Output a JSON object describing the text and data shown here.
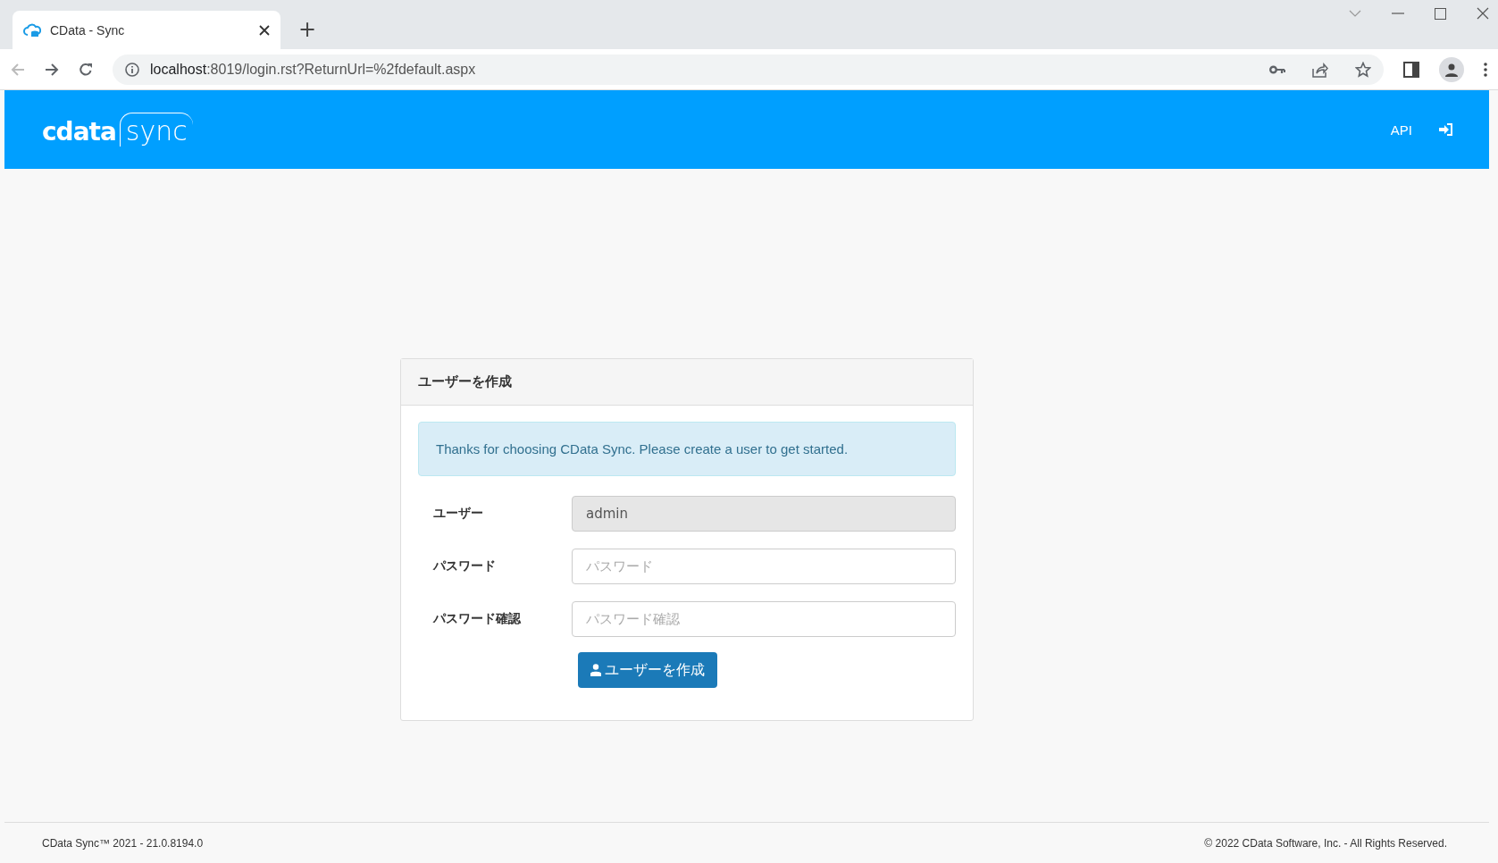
{
  "browser": {
    "tab_title": "CData - Sync",
    "new_tab": "+",
    "url_host": "localhost",
    "url_rest": ":8019/login.rst?ReturnUrl=%2fdefault.aspx"
  },
  "header": {
    "logo_left": "cdata",
    "logo_right": "sync",
    "nav": [
      {
        "label": "API",
        "kind": "text"
      },
      {
        "kind": "login-icon"
      }
    ]
  },
  "card": {
    "title": "ユーザーを作成",
    "alert": "Thanks for choosing CData Sync. Please create a user to get started.",
    "fields": [
      {
        "label": "ユーザー",
        "value": "admin",
        "disabled": true
      },
      {
        "label": "パスワード",
        "placeholder": "パスワード",
        "disabled": false
      },
      {
        "label": "パスワード確認",
        "placeholder": "パスワード確認",
        "disabled": false
      }
    ],
    "submit": "ユーザーを作成"
  },
  "footer": {
    "version": "CData Sync™ 2021 - 21.0.8194.0",
    "copyright": "© 2022 CData Software, Inc. - All Rights Reserved."
  }
}
